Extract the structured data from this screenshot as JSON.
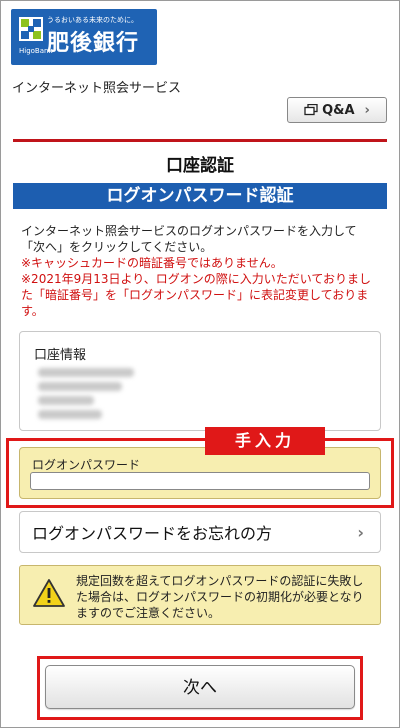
{
  "header": {
    "bank_tagline": "うるおいある未来のために。",
    "bank_name": "肥後銀行",
    "bank_name_en": "HigoBank",
    "service_name": "インターネット照会サービス",
    "qa_label": "Q&A"
  },
  "page": {
    "title": "口座認証",
    "section_title": "ログオンパスワード認証"
  },
  "instructions": {
    "main": "インターネット照会サービスのログオンパスワードを入力して「次へ」をクリックしてください。",
    "note1": "※キャッシュカードの暗証番号ではありません。",
    "note2": "※2021年9月13日より、ログオンの際に入力いただいておりました「暗証番号」を「ログオンパスワード」に表記変更しております。"
  },
  "account": {
    "title": "口座情報"
  },
  "password_field": {
    "label": "ログオンパスワード",
    "value": "",
    "manual_tag": "手入力"
  },
  "forgot": {
    "label": "ログオンパスワードをお忘れの方"
  },
  "warning": {
    "text": "規定回数を超えてログオンパスワードの認証に失敗した場合は、ログオンパスワードの初期化が必要となりますのでご注意ください。"
  },
  "actions": {
    "next_label": "次へ"
  },
  "colors": {
    "brand_blue": "#1d5eb0",
    "accent_red": "#c0141a",
    "highlight_red": "#e01818",
    "notice_yellow": "#f7eeb0"
  }
}
